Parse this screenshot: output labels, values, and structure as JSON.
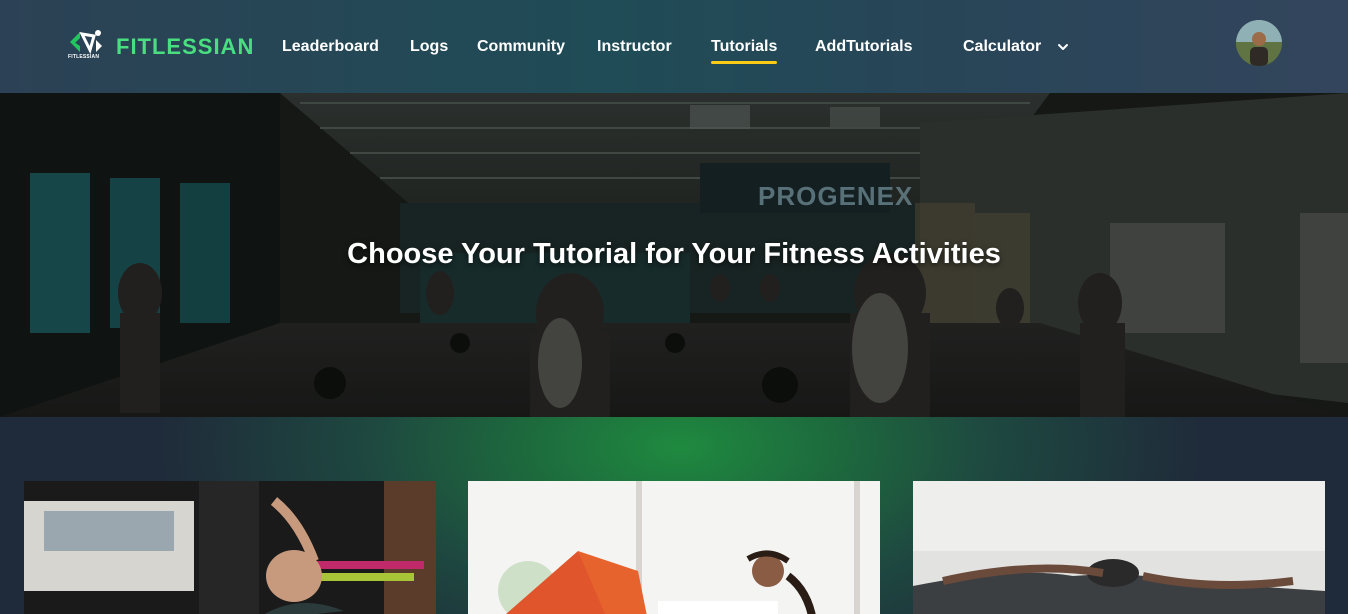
{
  "brand": {
    "name": "FITLESSIAN",
    "logo_tagline": "FITLESSIAN",
    "logo_icon": "fitlessian-logo-icon",
    "accent": "#4ade80"
  },
  "nav": {
    "items": [
      {
        "label": "Leaderboard"
      },
      {
        "label": "Logs"
      },
      {
        "label": "Community"
      },
      {
        "label": "Instructor"
      },
      {
        "label": "Tutorials",
        "active": true
      },
      {
        "label": "AddTutorials"
      },
      {
        "label": "Calculator",
        "icon": "chevron-down-icon"
      }
    ],
    "active_color": "#facc15"
  },
  "user": {
    "avatar_icon": "user-avatar"
  },
  "hero": {
    "title": "Choose Your Tutorial for Your Fitness Activities",
    "image": "gym-interior-photo",
    "wall_text": "PROGENEX"
  },
  "cards": [
    {
      "image": "woman-stretching-in-gym-photo"
    },
    {
      "image": "woman-doing-crunches-photo"
    },
    {
      "image": "woman-yoga-pose-photo"
    }
  ]
}
